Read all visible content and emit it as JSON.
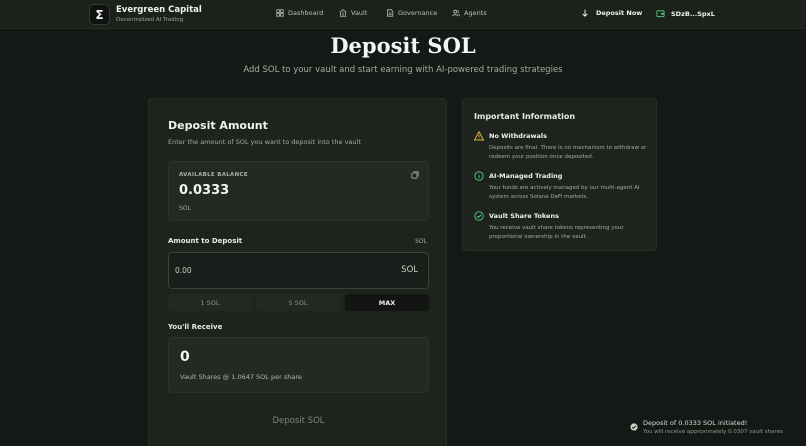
{
  "brand": {
    "logo_glyph": "Σ",
    "name": "Evergreen Capital",
    "subtitle": "Decentralized AI Trading"
  },
  "nav": {
    "links": [
      {
        "label": "Dashboard",
        "icon": "dashboard-icon"
      },
      {
        "label": "Vault",
        "icon": "vault-icon"
      },
      {
        "label": "Governance",
        "icon": "document-icon"
      },
      {
        "label": "Agents",
        "icon": "users-icon"
      }
    ],
    "deposit_now": "Deposit Now",
    "wallet_label": "SDzB...SpxL"
  },
  "page": {
    "title": "Deposit SOL",
    "subtitle": "Add SOL to your vault and start earning with AI-powered trading strategies"
  },
  "deposit": {
    "heading": "Deposit Amount",
    "description": "Enter the amount of SOL you want to deposit into the vault",
    "balance_label": "AVAILABLE BALANCE",
    "balance_value": "0.0333",
    "balance_unit": "SOL",
    "amount_label": "Amount to Deposit",
    "amount_unit_hint": "SOL",
    "amount_value": "0.00",
    "amount_suffix": "SOL",
    "presets": [
      "1 SOL",
      "5 SOL",
      "MAX"
    ],
    "receive_label": "You'll Receive",
    "receive_value": "0",
    "receive_rate": "Vault Shares @ 1.0647 SOL per share",
    "submit_label": "Deposit SOL"
  },
  "info": {
    "title": "Important Information",
    "items": [
      {
        "title": "No Withdrawals",
        "text": "Deposits are final. There is no mechanism to withdraw or redeem your position once deposited.",
        "icon": "warning-icon",
        "color": "#e0b43a"
      },
      {
        "title": "AI-Managed Trading",
        "text": "Your funds are actively managed by our multi-agent AI system across Solana DeFi markets.",
        "icon": "info-icon",
        "color": "#4fbf73"
      },
      {
        "title": "Vault Share Tokens",
        "text": "You receive vault share tokens representing your proportional ownership in the vault.",
        "icon": "check-circle-icon",
        "color": "#4fbf73"
      }
    ]
  },
  "toast": {
    "title": "Deposit of 0.0333 SOL initiated!",
    "description": "You will receive approximately 0.0307 vault shares"
  },
  "colors": {
    "accent": "#4fbf73",
    "warning": "#e0b43a",
    "background": "#151915",
    "card": "#1e231e"
  }
}
